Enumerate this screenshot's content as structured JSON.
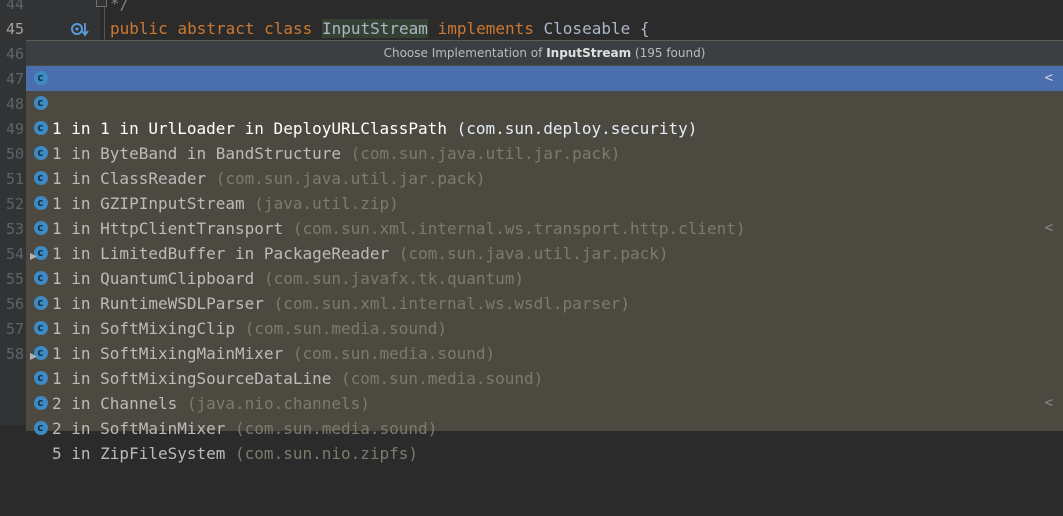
{
  "editor": {
    "line_numbers": [
      "44",
      "45",
      "46",
      "47",
      "48",
      "49",
      "50",
      "51",
      "52",
      "53",
      "54",
      "55",
      "56",
      "57",
      "58"
    ],
    "comment_line": "*/",
    "code_line": {
      "kw1": "public",
      "kw2": "abstract",
      "kw3": "class",
      "name": "InputStream",
      "kw4": "implements",
      "iface": "Closeable {"
    }
  },
  "popup": {
    "header_prefix": "Choose Implementation of ",
    "header_class": "InputStream",
    "header_suffix": " (195 found)",
    "items": [
      {
        "name": "1 in 1 in UrlLoader in DeployURLClassPath",
        "pkg": "(com.sun.deploy.security)",
        "arrow": "<"
      },
      {
        "name": "1 in ByteBand in BandStructure",
        "pkg": "(com.sun.java.util.jar.pack)",
        "arrow": ""
      },
      {
        "name": "1 in ClassReader",
        "pkg": "(com.sun.java.util.jar.pack)",
        "arrow": ""
      },
      {
        "name": "1 in GZIPInputStream",
        "pkg": "(java.util.zip)",
        "arrow": ""
      },
      {
        "name": "1 in HttpClientTransport",
        "pkg": "(com.sun.xml.internal.ws.transport.http.client)",
        "arrow": ""
      },
      {
        "name": "1 in LimitedBuffer in PackageReader",
        "pkg": "(com.sun.java.util.jar.pack)",
        "arrow": ""
      },
      {
        "name": "1 in QuantumClipboard",
        "pkg": "(com.sun.javafx.tk.quantum)",
        "arrow": "<"
      },
      {
        "name": "1 in RuntimeWSDLParser",
        "pkg": "(com.sun.xml.internal.ws.wsdl.parser)",
        "arrow": ""
      },
      {
        "name": "1 in SoftMixingClip",
        "pkg": "(com.sun.media.sound)",
        "arrow": ""
      },
      {
        "name": "1 in SoftMixingMainMixer",
        "pkg": "(com.sun.media.sound)",
        "arrow": ""
      },
      {
        "name": "1 in SoftMixingSourceDataLine",
        "pkg": "(com.sun.media.sound)",
        "arrow": ""
      },
      {
        "name": "2 in Channels",
        "pkg": "(java.nio.channels)",
        "arrow": ""
      },
      {
        "name": "2 in SoftMainMixer",
        "pkg": "(com.sun.media.sound)",
        "arrow": ""
      },
      {
        "name": "5 in ZipFileSystem",
        "pkg": "(com.sun.nio.zipfs)",
        "arrow": "<"
      }
    ]
  }
}
